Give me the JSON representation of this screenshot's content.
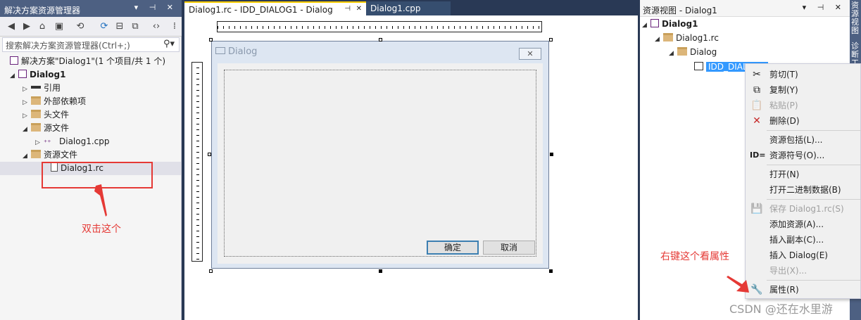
{
  "solution_explorer": {
    "title": "解决方案资源管理器",
    "title_buttons": "▾ ⊣ ✕",
    "search_placeholder": "搜索解决方案资源管理器(Ctrl+;)",
    "tree": [
      {
        "label": "解决方案\"Dialog1\"(1 个项目/共 1 个)"
      },
      {
        "label": "Dialog1"
      },
      {
        "label": "引用"
      },
      {
        "label": "外部依赖项"
      },
      {
        "label": "头文件"
      },
      {
        "label": "源文件"
      },
      {
        "label": "Dialog1.cpp"
      },
      {
        "label": "资源文件"
      },
      {
        "label": "Dialog1.rc"
      }
    ],
    "annotation": "双击这个"
  },
  "editor": {
    "tabs": [
      {
        "label": "Dialog1.rc - IDD_DIALOG1 - Dialog"
      },
      {
        "label": "Dialog1.cpp"
      }
    ],
    "tab_pin": "⊣",
    "tab_close": "✕",
    "dialog": {
      "title": "Dialog",
      "close": "✕",
      "ok_label": "确定",
      "cancel_label": "取消"
    }
  },
  "resource_view": {
    "title": "资源视图 - Dialog1",
    "title_buttons": "▾ ⊣ ✕",
    "tree": [
      {
        "label": "Dialog1"
      },
      {
        "label": "Dialog1.rc"
      },
      {
        "label": "Dialog"
      },
      {
        "label": "IDD_DIALOG1"
      }
    ],
    "side_tabs": [
      "资源视图",
      "诊断工"
    ],
    "annotation": "右键这个看属性"
  },
  "context_menu": {
    "items": [
      {
        "label": "剪切(T)",
        "icon": "cut-icon",
        "glyph": "✂",
        "disabled": false
      },
      {
        "label": "复制(Y)",
        "icon": "copy-icon",
        "glyph": "⧉",
        "disabled": false
      },
      {
        "label": "粘贴(P)",
        "icon": "paste-icon",
        "glyph": "📋",
        "disabled": true
      },
      {
        "label": "删除(D)",
        "icon": "delete-icon",
        "glyph": "✕",
        "disabled": false
      },
      {
        "label": "资源包括(L)...",
        "disabled": false
      },
      {
        "label": "资源符号(O)...",
        "icon": "id-icon",
        "glyph": "ID=",
        "disabled": false
      },
      {
        "label": "打开(N)",
        "disabled": false
      },
      {
        "label": "打开二进制数据(B)",
        "disabled": false
      },
      {
        "label": "保存 Dialog1.rc(S)",
        "icon": "save-icon",
        "glyph": "💾",
        "disabled": true
      },
      {
        "label": "添加资源(A)...",
        "disabled": false
      },
      {
        "label": "插入副本(C)...",
        "disabled": false
      },
      {
        "label": "插入 Dialog(E)",
        "disabled": false
      },
      {
        "label": "导出(X)...",
        "disabled": true
      },
      {
        "label": "属性(R)",
        "icon": "wrench-icon",
        "glyph": "🔧",
        "disabled": false
      }
    ]
  },
  "watermark": "CSDN @还在水里游",
  "colors": {
    "accent": "#ffcc00",
    "annotation_red": "#e53935",
    "selection_blue": "#3399ff",
    "panel_dark": "#293955"
  }
}
